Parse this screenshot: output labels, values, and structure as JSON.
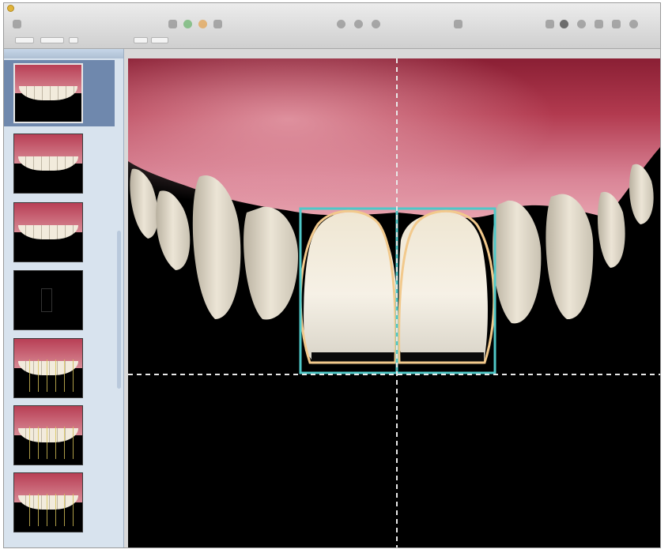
{
  "window": {
    "title": ""
  },
  "toolbar": {
    "buttons_left": [
      {
        "icon": "window-dot-icon"
      },
      {
        "icon": "view-icon"
      },
      {
        "icon": "color-icon"
      },
      {
        "icon": "orange-circle-icon"
      },
      {
        "icon": "tool-icon"
      }
    ],
    "buttons_right": [
      {
        "icon": "tool-icon"
      },
      {
        "icon": "dark-circle-icon"
      },
      {
        "icon": "info-icon"
      },
      {
        "icon": "share-icon"
      },
      {
        "icon": "media-icon"
      },
      {
        "icon": "help-icon"
      }
    ]
  },
  "sidebar": {
    "header_label": "",
    "thumbnails": [
      {
        "name": "slide-1",
        "selected": true,
        "kind": "smile"
      },
      {
        "name": "slide-2",
        "selected": false,
        "kind": "smile"
      },
      {
        "name": "slide-3",
        "selected": false,
        "kind": "smile"
      },
      {
        "name": "slide-4",
        "selected": false,
        "kind": "dark"
      },
      {
        "name": "slide-5",
        "selected": false,
        "kind": "smile-lines"
      },
      {
        "name": "slide-6",
        "selected": false,
        "kind": "smile-lines"
      },
      {
        "name": "slide-7",
        "selected": false,
        "kind": "smile-lines"
      }
    ]
  },
  "canvas": {
    "guides": {
      "style": "dashed",
      "color": "#e8e8e8"
    },
    "overlay_colors": {
      "box": "#4fc8c8",
      "tooth_outline": "#f2c98c"
    }
  }
}
